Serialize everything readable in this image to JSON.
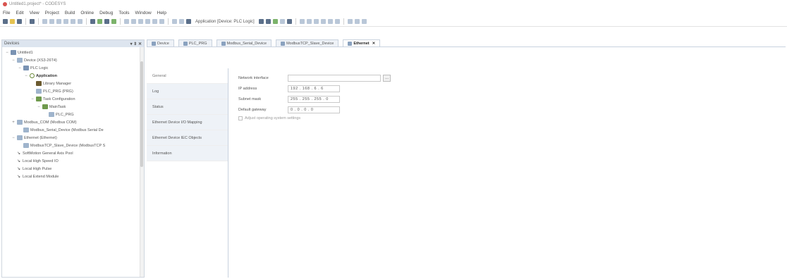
{
  "window": {
    "title": "Untitled1.project* - CODESYS"
  },
  "menu": [
    "File",
    "Edit",
    "View",
    "Project",
    "Build",
    "Online",
    "Debug",
    "Tools",
    "Window",
    "Help"
  ],
  "toolbar": {
    "active_app": "Application [Device: PLC Logic]"
  },
  "devices": {
    "title": "Devices",
    "pin_label": "▾ ⇕ ✕",
    "tree": [
      {
        "label": "Untitled1",
        "depth": 0,
        "toggle": "−",
        "icon": "folder"
      },
      {
        "label": "Device (XS3-26T4)",
        "depth": 1,
        "toggle": "−",
        "icon": "device"
      },
      {
        "label": "PLC Logic",
        "depth": 2,
        "toggle": "−",
        "icon": "folder"
      },
      {
        "label": "Application",
        "depth": 3,
        "toggle": "−",
        "icon": "app",
        "bold": true
      },
      {
        "label": "Library Manager",
        "depth": 4,
        "toggle": "",
        "icon": "lib"
      },
      {
        "label": "PLC_PRG (PRG)",
        "depth": 4,
        "toggle": "",
        "icon": "device"
      },
      {
        "label": "Task Configuration",
        "depth": 4,
        "toggle": "−",
        "icon": "task"
      },
      {
        "label": "MainTask",
        "depth": 5,
        "toggle": "−",
        "icon": "task"
      },
      {
        "label": "PLC_PRG",
        "depth": 6,
        "toggle": "",
        "icon": "device"
      },
      {
        "label": "Modbus_COM (Modbus COM)",
        "depth": 1,
        "toggle": "+",
        "icon": "device"
      },
      {
        "label": "Modbus_Serial_Device (Modbus Serial De",
        "depth": 2,
        "toggle": "",
        "icon": "device"
      },
      {
        "label": "Ethernet (Ethernet)",
        "depth": 1,
        "toggle": "−",
        "icon": "device"
      },
      {
        "label": "ModbusTCP_Slave_Device (ModbusTCP S",
        "depth": 2,
        "toggle": "",
        "icon": "device"
      },
      {
        "label": "SoftMotion General Axis Pool",
        "depth": 1,
        "toggle": "",
        "icon": "arrow"
      },
      {
        "label": "Local High Speed IO",
        "depth": 1,
        "toggle": "",
        "icon": "arrow"
      },
      {
        "label": "Local High Pulse",
        "depth": 1,
        "toggle": "",
        "icon": "arrow"
      },
      {
        "label": "Local Extend Module",
        "depth": 1,
        "toggle": "",
        "icon": "arrow"
      }
    ]
  },
  "tabs": [
    {
      "label": "Device",
      "active": false
    },
    {
      "label": "PLC_PRG",
      "active": false
    },
    {
      "label": "Modbus_Serial_Device",
      "active": false
    },
    {
      "label": "ModbusTCP_Slave_Device",
      "active": false
    },
    {
      "label": "Ethernet",
      "active": true,
      "close": "✕"
    }
  ],
  "editor_nav": [
    {
      "label": "General",
      "active": false
    },
    {
      "label": "Log",
      "active": true
    },
    {
      "label": "Status",
      "active": true
    },
    {
      "label": "Ethernet Device I/O Mapping",
      "active": true
    },
    {
      "label": "Ethernet Device IEC Objects",
      "active": true
    },
    {
      "label": "Information",
      "active": true
    }
  ],
  "ethernet": {
    "network_interface_label": "Network interface",
    "network_interface_value": "",
    "browse_label": "...",
    "ip_label": "IP address",
    "ip_value": "192 . 168 . 6 . 6",
    "subnet_label": "Subnet mask",
    "subnet_value": "255 . 255 . 255 . 0",
    "gateway_label": "Default gateway",
    "gateway_value": "0 . 0 . 0 . 0",
    "adjust_label": "Adjust operating system settings",
    "adjust_checked": false
  }
}
